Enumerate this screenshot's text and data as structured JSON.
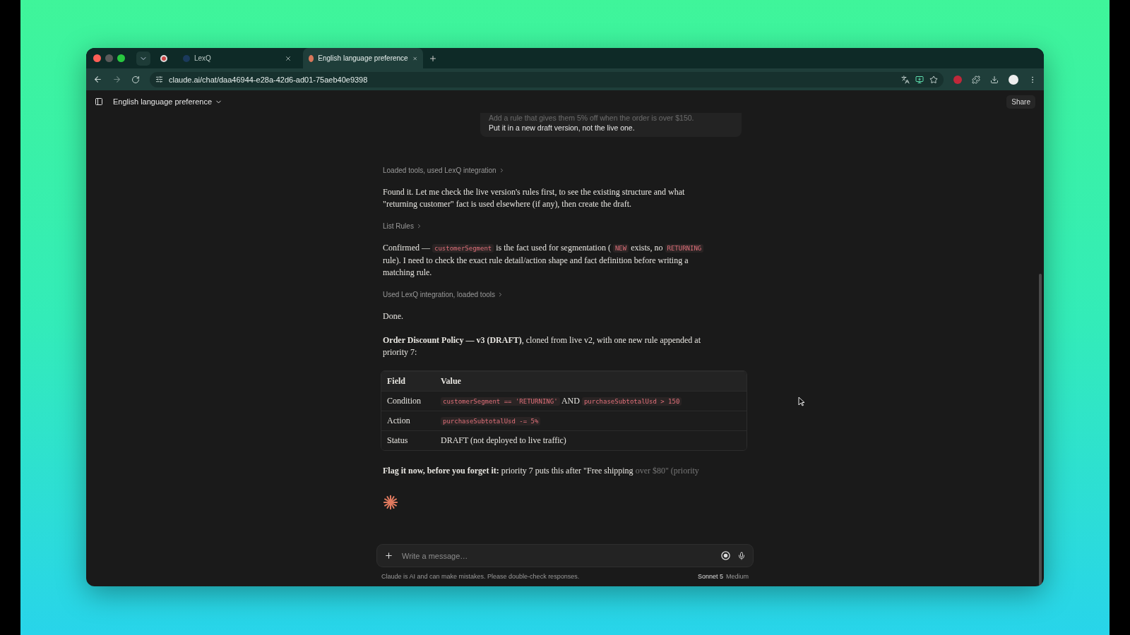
{
  "browser": {
    "tabs": [
      {
        "title": "LexQ",
        "selected": false
      },
      {
        "title": "English language preference",
        "selected": true
      }
    ],
    "url": "claude.ai/chat/daa46944-e28a-42d6-ad01-75aeb40e9398"
  },
  "header": {
    "title": "English language preference",
    "share": "Share"
  },
  "user_message": {
    "lines": [
      "Add a rule that gives them 5% off when the order is over $150.",
      "Put it in a new draft version, not the live one."
    ]
  },
  "messages": [
    {
      "kind": "tool",
      "text": "Loaded tools, used LexQ integration"
    },
    {
      "kind": "para",
      "segments": [
        {
          "kind": "text",
          "text": "Found it. Let me check the live version's rules first, to see the existing structure and what \"returning customer\" fact is used elsewhere (if any), then create the draft."
        }
      ]
    },
    {
      "kind": "tool",
      "text": "List Rules"
    },
    {
      "kind": "para",
      "segments": [
        {
          "kind": "text",
          "text": "Confirmed — "
        },
        {
          "kind": "code",
          "text": "customerSegment"
        },
        {
          "kind": "text",
          "text": " is the fact used for segmentation ( "
        },
        {
          "kind": "code",
          "text": "NEW"
        },
        {
          "kind": "text",
          "text": " exists, no "
        },
        {
          "kind": "code",
          "text": "RETURNING"
        },
        {
          "kind": "text",
          "text": " rule). I need to check the exact rule detail/action shape and fact definition before writing a matching rule."
        }
      ]
    },
    {
      "kind": "tool",
      "text": "Used LexQ integration, loaded tools"
    },
    {
      "kind": "para",
      "segments": [
        {
          "kind": "text",
          "text": "Done."
        }
      ]
    },
    {
      "kind": "para",
      "segments": [
        {
          "kind": "bold",
          "text": "Order Discount Policy — v3 (DRAFT)"
        },
        {
          "kind": "text",
          "text": ", cloned from live v2, with one new rule appended at priority 7:"
        }
      ]
    },
    {
      "kind": "table",
      "columns": [
        "Field",
        "Value"
      ],
      "rows": [
        {
          "field": "Condition",
          "value": [
            {
              "kind": "code",
              "text": "customerSegment == 'RETURNING'"
            },
            {
              "kind": "text",
              "text": " AND "
            },
            {
              "kind": "code",
              "text": "purchaseSubtotalUsd > 150"
            }
          ]
        },
        {
          "field": "Action",
          "value": [
            {
              "kind": "code",
              "text": "purchaseSubtotalUsd -= 5%"
            }
          ]
        },
        {
          "field": "Status",
          "value": [
            {
              "kind": "text",
              "text": "DRAFT (not deployed to live traffic)"
            }
          ]
        }
      ]
    },
    {
      "kind": "para",
      "segments": [
        {
          "kind": "bold",
          "text": "Flag it now, before you forget it:"
        },
        {
          "kind": "text",
          "text": " priority 7 puts this after \"Free shipping"
        },
        {
          "kind": "faded",
          "text": " over $80\" (priority"
        }
      ]
    }
  ],
  "composer": {
    "placeholder": "Write a message…",
    "disclaimer": "Claude is AI and can make mistakes. Please double-check responses.",
    "model": "Sonnet 5",
    "effort": "Medium"
  }
}
